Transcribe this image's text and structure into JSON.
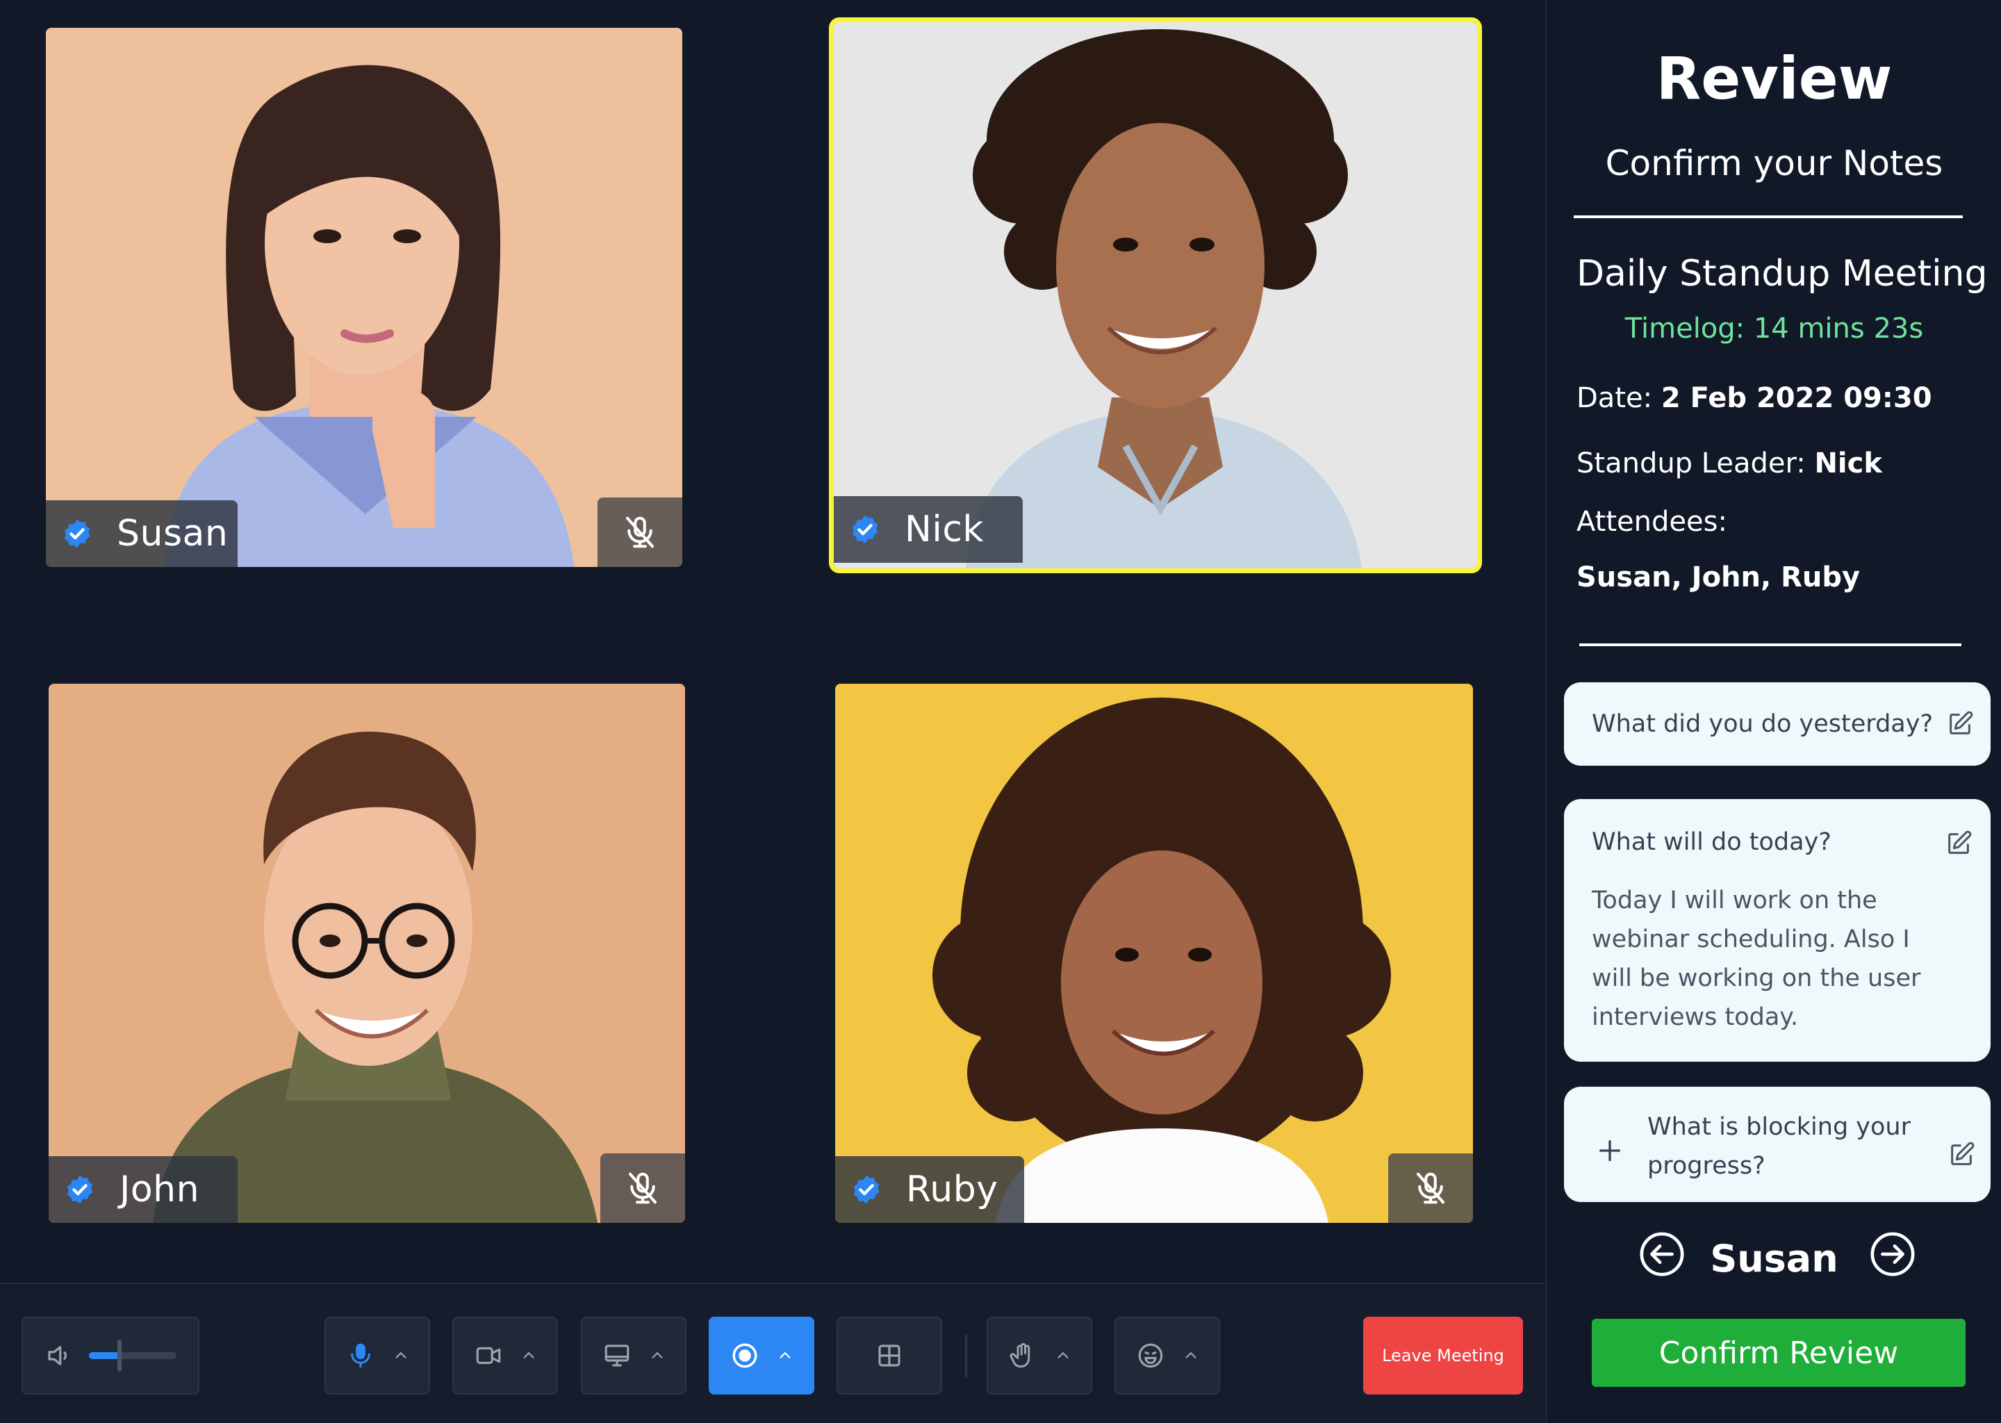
{
  "participants": [
    {
      "name": "Susan",
      "verified_icon": "verified-badge-icon",
      "mic_icon": "mic-muted-icon",
      "bg": "#eec19c"
    },
    {
      "name": "Nick",
      "verified_icon": "verified-badge-icon",
      "active_speaker": true,
      "bg": "#e6e6e6"
    },
    {
      "name": "John",
      "verified_icon": "verified-badge-icon",
      "mic_icon": "mic-muted-icon",
      "bg": "#e4ad84"
    },
    {
      "name": "Ruby",
      "verified_icon": "verified-badge-icon",
      "mic_icon": "mic-muted-icon",
      "bg": "#f2c542"
    }
  ],
  "toolbar": {
    "volume": {
      "icon": "speaker-icon",
      "level": 0.35
    },
    "mic": {
      "icon": "microphone-icon",
      "caret": "chevron-up-icon"
    },
    "camera": {
      "icon": "video-camera-icon",
      "caret": "chevron-up-icon"
    },
    "screen": {
      "icon": "monitor-icon",
      "caret": "chevron-up-icon"
    },
    "record": {
      "icon": "record-icon",
      "caret": "chevron-up-icon",
      "active_color": "#2c87f5"
    },
    "layout": {
      "icon": "grid-layout-icon"
    },
    "hand": {
      "icon": "raise-hand-icon",
      "caret": "chevron-up-icon"
    },
    "reactions": {
      "icon": "emoji-icon",
      "caret": "chevron-up-icon"
    },
    "leave_label": "Leave Meeting",
    "leave_color": "#ef4444"
  },
  "review": {
    "title": "Review",
    "subtitle": "Confirm your Notes",
    "meeting_name": "Daily Standup Meeting",
    "timelog": "Timelog: 14 mins 23s",
    "date_label": "Date:",
    "date_value": "2 Feb 2022 09:30",
    "leader_label": "Standup Leader:",
    "leader_value": "Nick",
    "attendees_label": "Attendees:",
    "attendees_value": "Susan, John, Ruby",
    "questions": [
      {
        "question": "What did you do yesterday?",
        "answer": "",
        "icon": "edit-icon"
      },
      {
        "question": "What will do today?",
        "answer": "Today I will work on the webinar scheduling. Also I will be working on the user interviews today.",
        "icon": "edit-icon"
      },
      {
        "question": "What is blocking your progress?",
        "answer": "",
        "icon": "edit-icon",
        "add_icon": "plus-icon"
      }
    ],
    "current_person": "Susan",
    "prev_icon": "arrow-left-circle-icon",
    "next_icon": "arrow-right-circle-icon",
    "confirm_label": "Confirm Review",
    "confirm_color": "#1fae3a",
    "timelog_color": "#6fe39b"
  }
}
